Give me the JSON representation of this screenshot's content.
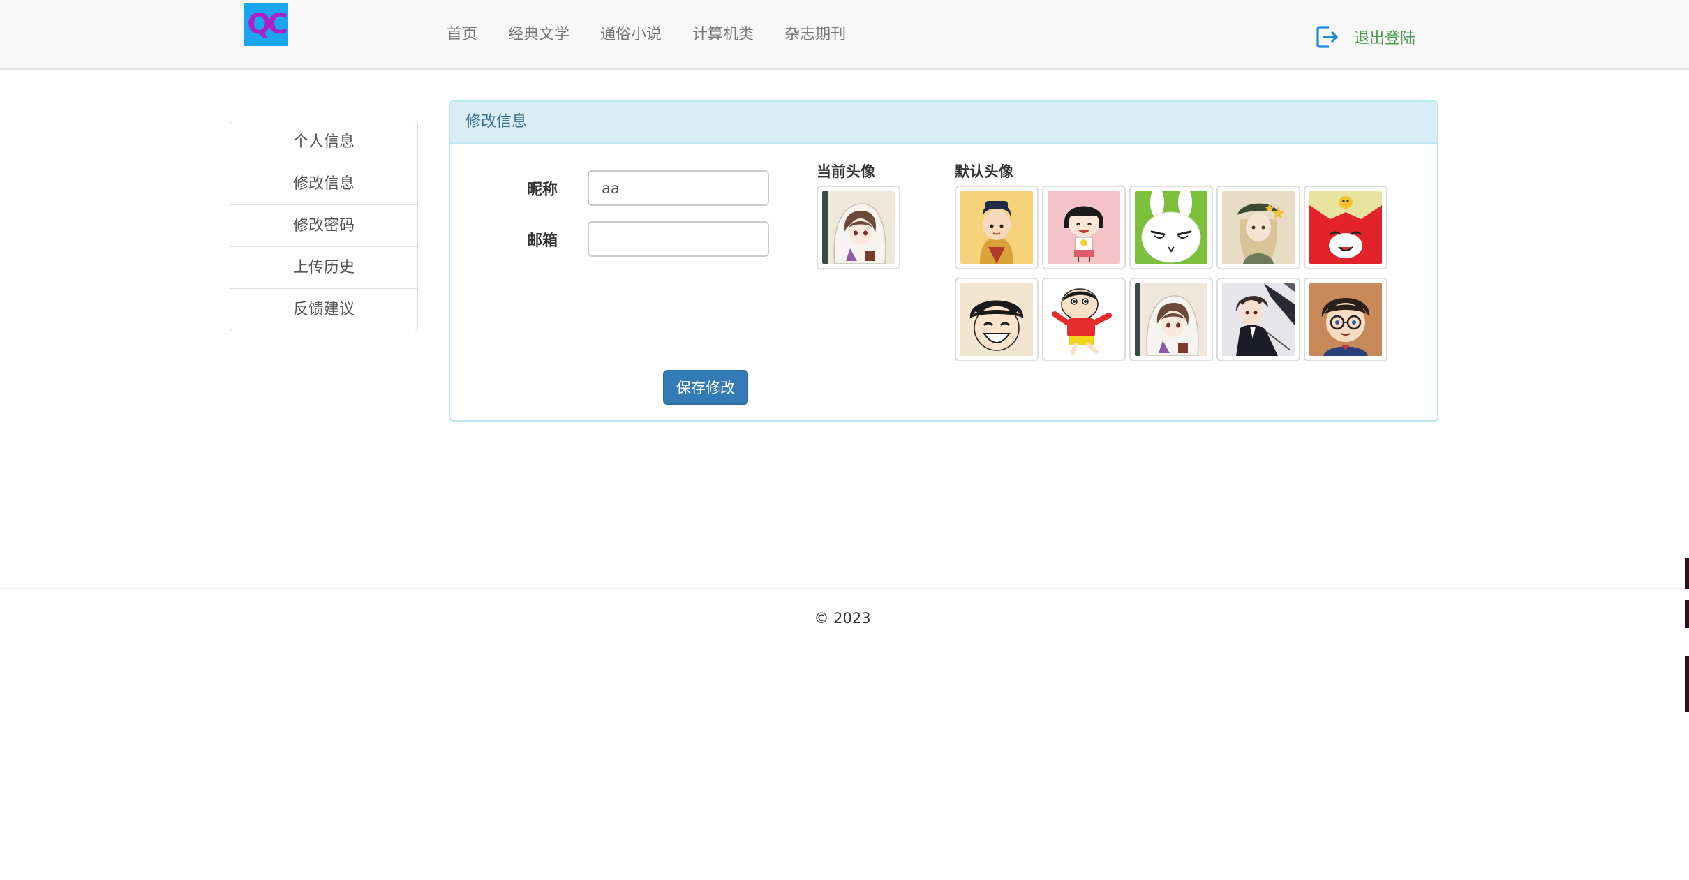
{
  "navbar": {
    "logo_text": "QC",
    "links": [
      "首页",
      "经典文学",
      "通俗小说",
      "计算机类",
      "杂志期刊"
    ],
    "logout_label": "退出登陆",
    "logout_icon": "logout-icon"
  },
  "sidebar": {
    "items": [
      {
        "label": "个人信息"
      },
      {
        "label": "修改信息"
      },
      {
        "label": "修改密码"
      },
      {
        "label": "上传历史"
      },
      {
        "label": "反馈建议"
      }
    ]
  },
  "panel": {
    "title": "修改信息",
    "nickname_label": "昵称",
    "nickname_value": "aa",
    "email_label": "邮箱",
    "email_value": "",
    "save_label": "保存修改",
    "current_avatar_title": "当前头像",
    "default_avatar_title": "默认头像",
    "default_avatars": [
      "prince-avatar",
      "maruko-avatar",
      "bunny-avatar",
      "girl-beret-avatar",
      "red-fox-avatar",
      "luffy-avatar",
      "shinchan-avatar",
      "hooded-girl-avatar",
      "dark-boy-avatar",
      "conan-avatar"
    ],
    "current_avatar": "hooded-girl-avatar"
  },
  "footer": {
    "copyright": "© 2023"
  },
  "colors": {
    "navbar_bg": "#f8f8f8",
    "panel_heading_bg": "#d9edf7",
    "panel_heading_text": "#31708f",
    "primary_button": "#337ab7",
    "logout_text": "#4a9a4f",
    "logout_icon": "#1e88e5",
    "logo_bg": "#19a6ee",
    "logo_text": "#b01fc6"
  }
}
